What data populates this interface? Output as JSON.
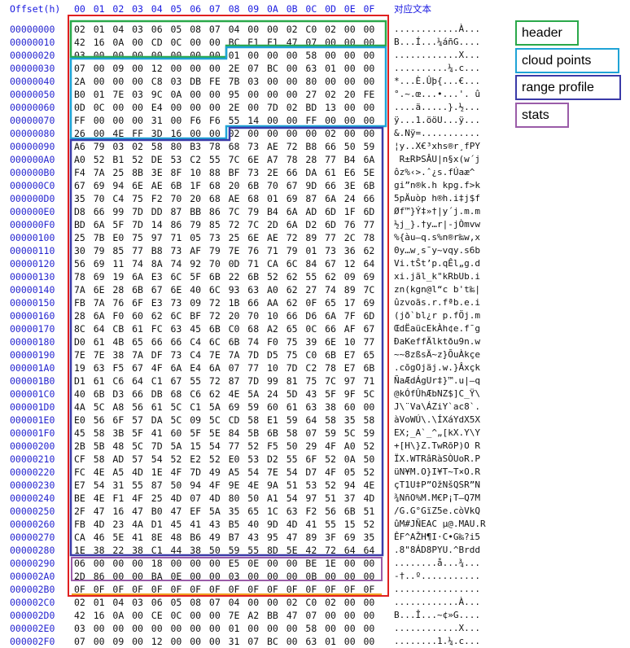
{
  "columns_header": {
    "offset_label": "Offset(h)",
    "bytes": [
      "00",
      "01",
      "02",
      "03",
      "04",
      "05",
      "06",
      "07",
      "08",
      "09",
      "0A",
      "0B",
      "0C",
      "0D",
      "0E",
      "0F"
    ],
    "text_label": "对应文本"
  },
  "rows": [
    {
      "offset": "00000000",
      "hex": [
        "02",
        "01",
        "04",
        "03",
        "06",
        "05",
        "08",
        "07",
        "04",
        "00",
        "00",
        "02",
        "C0",
        "02",
        "00",
        "00"
      ],
      "text": "............À..."
    },
    {
      "offset": "00000010",
      "hex": [
        "42",
        "16",
        "0A",
        "00",
        "CD",
        "0C",
        "00",
        "00",
        "BC",
        "E1",
        "F1",
        "47",
        "07",
        "00",
        "00",
        "00"
      ],
      "text": "B...Í...¼áñG...."
    },
    {
      "offset": "00000020",
      "hex": [
        "03",
        "00",
        "00",
        "00",
        "00",
        "00",
        "00",
        "00",
        "01",
        "00",
        "00",
        "00",
        "58",
        "00",
        "00",
        "00"
      ],
      "text": "............X..."
    },
    {
      "offset": "00000030",
      "hex": [
        "07",
        "00",
        "09",
        "00",
        "12",
        "00",
        "00",
        "00",
        "2E",
        "07",
        "BC",
        "00",
        "63",
        "01",
        "00",
        "00"
      ],
      "text": "..........¼.c..."
    },
    {
      "offset": "00000040",
      "hex": [
        "2A",
        "00",
        "00",
        "00",
        "C8",
        "03",
        "DB",
        "FE",
        "7B",
        "03",
        "00",
        "00",
        "80",
        "00",
        "00",
        "00"
      ],
      "text": "*...È.Ûþ{...€..."
    },
    {
      "offset": "00000050",
      "hex": [
        "B0",
        "01",
        "7E",
        "03",
        "9C",
        "0A",
        "00",
        "00",
        "95",
        "00",
        "00",
        "00",
        "27",
        "02",
        "20",
        "FE"
      ],
      "text": "°.~.œ...•...'. û"
    },
    {
      "offset": "00000060",
      "hex": [
        "0D",
        "0C",
        "00",
        "00",
        "E4",
        "00",
        "00",
        "00",
        "2E",
        "00",
        "7D",
        "02",
        "BD",
        "13",
        "00",
        "00"
      ],
      "text": "....ä.....}.½..."
    },
    {
      "offset": "00000070",
      "hex": [
        "FF",
        "00",
        "00",
        "00",
        "31",
        "00",
        "F6",
        "F6",
        "55",
        "14",
        "00",
        "00",
        "FF",
        "00",
        "00",
        "00"
      ],
      "text": "ÿ...1.ööU...ÿ..."
    },
    {
      "offset": "00000080",
      "hex": [
        "26",
        "00",
        "4E",
        "FF",
        "3D",
        "16",
        "00",
        "00",
        "02",
        "00",
        "00",
        "00",
        "00",
        "02",
        "00",
        "00"
      ],
      "text": "&.Nÿ=..........."
    },
    {
      "offset": "00000090",
      "hex": [
        "A6",
        "79",
        "03",
        "02",
        "58",
        "80",
        "B3",
        "78",
        "68",
        "73",
        "AE",
        "72",
        "B8",
        "66",
        "50",
        "59"
      ],
      "text": "¦y..X€³xhs®r¸fPY"
    },
    {
      "offset": "000000A0",
      "hex": [
        "A0",
        "52",
        "B1",
        "52",
        "DE",
        "53",
        "C2",
        "55",
        "7C",
        "6E",
        "A7",
        "78",
        "28",
        "77",
        "B4",
        "6A"
      ],
      "text": " R±RÞSÂU|n§x(w´j"
    },
    {
      "offset": "000000B0",
      "hex": [
        "F4",
        "7A",
        "25",
        "8B",
        "3E",
        "8F",
        "10",
        "88",
        "BF",
        "73",
        "2E",
        "66",
        "DA",
        "61",
        "E6",
        "5E"
      ],
      "text": "ôz%‹>.ˆ¿s.fÚaæ^"
    },
    {
      "offset": "000000C0",
      "hex": [
        "67",
        "69",
        "94",
        "6E",
        "AE",
        "6B",
        "1F",
        "68",
        "20",
        "6B",
        "70",
        "67",
        "9D",
        "66",
        "3E",
        "6B"
      ],
      "text": "gi”n®k.h kpg.f>k"
    },
    {
      "offset": "000000D0",
      "hex": [
        "35",
        "70",
        "C4",
        "75",
        "F2",
        "70",
        "20",
        "68",
        "AE",
        "68",
        "01",
        "69",
        "87",
        "6A",
        "24",
        "66"
      ],
      "text": "5pÄuòp h®h.i‡j$f"
    },
    {
      "offset": "000000E0",
      "hex": [
        "D8",
        "66",
        "99",
        "7D",
        "DD",
        "87",
        "BB",
        "86",
        "7C",
        "79",
        "B4",
        "6A",
        "AD",
        "6D",
        "1F",
        "6D"
      ],
      "text": "Øf™}Ý‡»†|y´j.m.m"
    },
    {
      "offset": "000000F0",
      "hex": [
        "BD",
        "6A",
        "5F",
        "7D",
        "14",
        "86",
        "79",
        "85",
        "72",
        "7C",
        "2D",
        "6A",
        "D2",
        "6D",
        "76",
        "77"
      ],
      "text": "½j_}.†y…r|-jÒmvw"
    },
    {
      "offset": "00000100",
      "hex": [
        "25",
        "7B",
        "E0",
        "75",
        "97",
        "71",
        "05",
        "73",
        "25",
        "6E",
        "AE",
        "72",
        "89",
        "77",
        "2C",
        "78"
      ],
      "text": "%{àu—q.s%n®r‰w,x"
    },
    {
      "offset": "00000110",
      "hex": [
        "30",
        "79",
        "85",
        "77",
        "B8",
        "73",
        "AF",
        "79",
        "7E",
        "76",
        "71",
        "79",
        "01",
        "73",
        "36",
        "62"
      ],
      "text": "0y…w¸s¯y~vqy.s6b"
    },
    {
      "offset": "00000120",
      "hex": [
        "56",
        "69",
        "11",
        "74",
        "8A",
        "74",
        "92",
        "70",
        "0D",
        "71",
        "CA",
        "6C",
        "84",
        "67",
        "12",
        "64"
      ],
      "text": "Vi.tŠt’p.qÊl„g.d"
    },
    {
      "offset": "00000130",
      "hex": [
        "78",
        "69",
        "19",
        "6A",
        "E3",
        "6C",
        "5F",
        "6B",
        "22",
        "6B",
        "52",
        "62",
        "55",
        "62",
        "09",
        "69"
      ],
      "text": "xi.jãl_k\"kRbUb.i"
    },
    {
      "offset": "00000140",
      "hex": [
        "7A",
        "6E",
        "28",
        "6B",
        "67",
        "6E",
        "40",
        "6C",
        "93",
        "63",
        "A0",
        "62",
        "27",
        "74",
        "89",
        "7C"
      ],
      "text": "zn(kgn@l“c b't‰|"
    },
    {
      "offset": "00000150",
      "hex": [
        "FB",
        "7A",
        "76",
        "6F",
        "E3",
        "73",
        "09",
        "72",
        "1B",
        "66",
        "AA",
        "62",
        "0F",
        "65",
        "17",
        "69"
      ],
      "text": "ûzvoãs.r.fªb.e.i"
    },
    {
      "offset": "00000160",
      "hex": [
        "28",
        "6A",
        "F0",
        "60",
        "62",
        "6C",
        "BF",
        "72",
        "20",
        "70",
        "10",
        "66",
        "D6",
        "6A",
        "7F",
        "6D"
      ],
      "text": "(jð`bl¿r p.fÖj.m"
    },
    {
      "offset": "00000170",
      "hex": [
        "8C",
        "64",
        "CB",
        "61",
        "FC",
        "63",
        "45",
        "6B",
        "C0",
        "68",
        "A2",
        "65",
        "0C",
        "66",
        "AF",
        "67"
      ],
      "text": "ŒdËaücEkÀh¢e.f¯g"
    },
    {
      "offset": "00000180",
      "hex": [
        "D0",
        "61",
        "4B",
        "65",
        "66",
        "66",
        "C4",
        "6C",
        "6B",
        "74",
        "F0",
        "75",
        "39",
        "6E",
        "10",
        "77"
      ],
      "text": "ÐaKeffÄlktðu9n.w"
    },
    {
      "offset": "00000190",
      "hex": [
        "7E",
        "7E",
        "38",
        "7A",
        "DF",
        "73",
        "C4",
        "7E",
        "7A",
        "7D",
        "D5",
        "75",
        "C0",
        "6B",
        "E7",
        "65"
      ],
      "text": "~~8zßsÄ~z}ÕuÀkçe"
    },
    {
      "offset": "000001A0",
      "hex": [
        "19",
        "63",
        "F5",
        "67",
        "4F",
        "6A",
        "E4",
        "6A",
        "07",
        "77",
        "10",
        "7D",
        "C2",
        "78",
        "E7",
        "6B"
      ],
      "text": ".cõgOjäj.w.}Âxçk"
    },
    {
      "offset": "000001B0",
      "hex": [
        "D1",
        "61",
        "C6",
        "64",
        "C1",
        "67",
        "55",
        "72",
        "87",
        "7D",
        "99",
        "81",
        "75",
        "7C",
        "97",
        "71"
      ],
      "text": "ÑaÆdÁgUr‡}™.u|—q"
    },
    {
      "offset": "000001C0",
      "hex": [
        "40",
        "6B",
        "D3",
        "66",
        "DB",
        "68",
        "C6",
        "62",
        "4E",
        "5A",
        "24",
        "5D",
        "43",
        "5F",
        "9F",
        "5C"
      ],
      "text": "@kÓfÛhÆbNZ$]C_Ÿ\\"
    },
    {
      "offset": "000001D0",
      "hex": [
        "4A",
        "5C",
        "A8",
        "56",
        "61",
        "5C",
        "C1",
        "5A",
        "69",
        "59",
        "60",
        "61",
        "63",
        "38",
        "60",
        "00"
      ],
      "text": "J\\¨Va\\ÁZiY`ac8`."
    },
    {
      "offset": "000001E0",
      "hex": [
        "E0",
        "56",
        "6F",
        "57",
        "DA",
        "5C",
        "09",
        "5C",
        "CD",
        "58",
        "E1",
        "59",
        "64",
        "58",
        "35",
        "58"
      ],
      "text": "àVoWÚ\\.\\ÍXáYdX5X"
    },
    {
      "offset": "000001F0",
      "hex": [
        "45",
        "58",
        "3B",
        "5F",
        "41",
        "60",
        "5F",
        "5E",
        "84",
        "5B",
        "6B",
        "58",
        "07",
        "59",
        "5C",
        "59"
      ],
      "text": "EX;_A`_^„[kX.Y\\Y"
    },
    {
      "offset": "00000200",
      "hex": [
        "2B",
        "5B",
        "48",
        "5C",
        "7D",
        "5A",
        "15",
        "54",
        "77",
        "52",
        "F5",
        "50",
        "29",
        "4F",
        "A0",
        "52"
      ],
      "text": "+[H\\}Z.TwRõP)O R"
    },
    {
      "offset": "00000210",
      "hex": [
        "CF",
        "58",
        "AD",
        "57",
        "54",
        "52",
        "E2",
        "52",
        "E0",
        "53",
        "D2",
        "55",
        "6F",
        "52",
        "0A",
        "50"
      ],
      "text": "ÏX.WTRâRàSÒUoR.P"
    },
    {
      "offset": "00000220",
      "hex": [
        "FC",
        "4E",
        "A5",
        "4D",
        "1E",
        "4F",
        "7D",
        "49",
        "A5",
        "54",
        "7E",
        "54",
        "D7",
        "4F",
        "05",
        "52"
      ],
      "text": "üN¥M.O}I¥T~T×O.R"
    },
    {
      "offset": "00000230",
      "hex": [
        "E7",
        "54",
        "31",
        "55",
        "87",
        "50",
        "94",
        "4F",
        "9E",
        "4E",
        "9A",
        "51",
        "53",
        "52",
        "94",
        "4E"
      ],
      "text": "çT1U‡P”OžNšQSR”N"
    },
    {
      "offset": "00000240",
      "hex": [
        "BE",
        "4E",
        "F1",
        "4F",
        "25",
        "4D",
        "07",
        "4D",
        "80",
        "50",
        "A1",
        "54",
        "97",
        "51",
        "37",
        "4D"
      ],
      "text": "¾NñO%M.M€P¡T—Q7M"
    },
    {
      "offset": "00000250",
      "hex": [
        "2F",
        "47",
        "16",
        "47",
        "B0",
        "47",
        "EF",
        "5A",
        "35",
        "65",
        "1C",
        "63",
        "F2",
        "56",
        "6B",
        "51"
      ],
      "text": "/G.G°GïZ5e.còVkQ"
    },
    {
      "offset": "00000260",
      "hex": [
        "FB",
        "4D",
        "23",
        "4A",
        "D1",
        "45",
        "41",
        "43",
        "B5",
        "40",
        "9D",
        "4D",
        "41",
        "55",
        "15",
        "52"
      ],
      "text": "ûM#JÑEAC µ@.MAU.R"
    },
    {
      "offset": "00000270",
      "hex": [
        "CA",
        "46",
        "5E",
        "41",
        "8E",
        "48",
        "B6",
        "49",
        "B7",
        "43",
        "95",
        "47",
        "89",
        "3F",
        "69",
        "35"
      ],
      "text": "ÊF^AŽH¶I·C•G‰?i5"
    },
    {
      "offset": "00000280",
      "hex": [
        "1E",
        "38",
        "22",
        "38",
        "C1",
        "44",
        "38",
        "50",
        "59",
        "55",
        "8D",
        "5E",
        "42",
        "72",
        "64",
        "64"
      ],
      "text": ".8\"8ÁD8PYU.^Brdd"
    },
    {
      "offset": "00000290",
      "hex": [
        "06",
        "00",
        "00",
        "00",
        "18",
        "00",
        "00",
        "00",
        "E5",
        "0E",
        "00",
        "00",
        "BE",
        "1E",
        "00",
        "00"
      ],
      "text": "........å...¾..."
    },
    {
      "offset": "000002A0",
      "hex": [
        "2D",
        "86",
        "00",
        "00",
        "BA",
        "0E",
        "00",
        "00",
        "03",
        "00",
        "00",
        "00",
        "0B",
        "00",
        "00",
        "00"
      ],
      "text": "-†..º..........."
    },
    {
      "offset": "000002B0",
      "hex": [
        "0F",
        "0F",
        "0F",
        "0F",
        "0F",
        "0F",
        "0F",
        "0F",
        "0F",
        "0F",
        "0F",
        "0F",
        "0F",
        "0F",
        "0F",
        "0F"
      ],
      "text": "................"
    },
    {
      "offset": "000002C0",
      "hex": [
        "02",
        "01",
        "04",
        "03",
        "06",
        "05",
        "08",
        "07",
        "04",
        "00",
        "00",
        "02",
        "C0",
        "02",
        "00",
        "00"
      ],
      "text": "............À..."
    },
    {
      "offset": "000002D0",
      "hex": [
        "42",
        "16",
        "0A",
        "00",
        "CE",
        "0C",
        "00",
        "00",
        "7E",
        "A2",
        "BB",
        "47",
        "07",
        "00",
        "00",
        "00"
      ],
      "text": "B...Î...~¢»G...."
    },
    {
      "offset": "000002E0",
      "hex": [
        "03",
        "00",
        "00",
        "00",
        "00",
        "00",
        "00",
        "00",
        "01",
        "00",
        "00",
        "00",
        "58",
        "00",
        "00",
        "00"
      ],
      "text": "............X..."
    },
    {
      "offset": "000002F0",
      "hex": [
        "07",
        "00",
        "09",
        "00",
        "12",
        "00",
        "00",
        "00",
        "31",
        "07",
        "BC",
        "00",
        "63",
        "01",
        "00",
        "00"
      ],
      "text": "........1.¼.c..."
    }
  ],
  "legend": [
    {
      "label": "header",
      "color": "#2aa84a"
    },
    {
      "label": "cloud points",
      "color": "#1fa3d6"
    },
    {
      "label": "range profile",
      "color": "#3a3aa8"
    },
    {
      "label": "stats",
      "color": "#9a5ca8"
    }
  ],
  "colors": {
    "outer_frame": "#e02020",
    "header": "#2aa84a",
    "cloud_points": "#1fa3d6",
    "range_profile": "#3a3aa8",
    "stats": "#9a5ca8",
    "underline": "#f0a020"
  }
}
